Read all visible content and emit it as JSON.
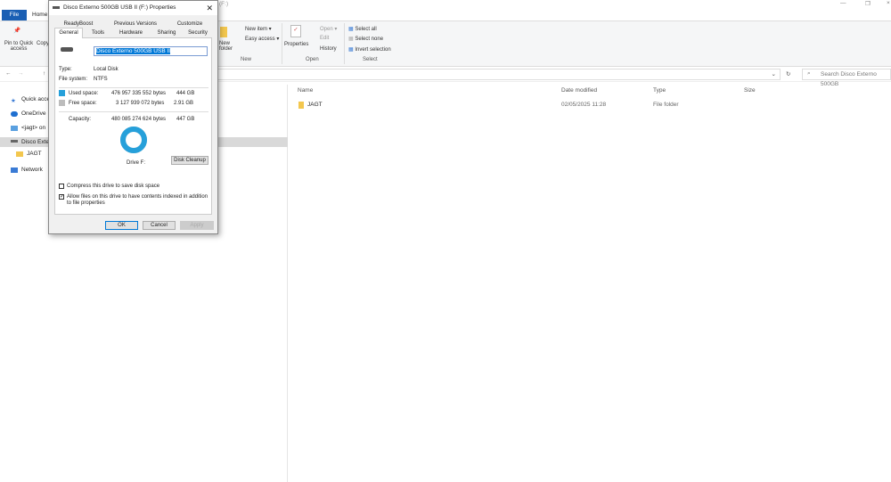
{
  "explorer": {
    "title_suffix": "(F:)",
    "tabs": {
      "file": "File",
      "home": "Home"
    },
    "ribbon": {
      "pin": "Pin to Quick access",
      "copy": "Copy",
      "new_folder": "New folder",
      "new_item": "New item ▾",
      "easy_access": "Easy access ▾",
      "properties": "Properties",
      "open": "Open ▾",
      "edit": "Edit",
      "history": "History",
      "select_all": "Select all",
      "select_none": "Select none",
      "invert_selection": "Invert selection",
      "groups": {
        "new": "New",
        "open": "Open",
        "select": "Select"
      }
    },
    "search_placeholder": "Search Disco Externo 500GB",
    "nav": [
      "Quick access",
      "OneDrive",
      "<jagt> on",
      "Disco Externo",
      "JAGT",
      "Network"
    ],
    "columns": [
      "Name",
      "Date modified",
      "Type",
      "Size"
    ],
    "files": [
      {
        "name": "JAGT",
        "date": "02/05/2025 11:28",
        "type": "File folder",
        "size": ""
      }
    ]
  },
  "dialog": {
    "title": "Disco Externo 500GB USB II (F:) Properties",
    "tabs_top": [
      "ReadyBoost",
      "Previous Versions",
      "Customize"
    ],
    "tabs_bottom": [
      "General",
      "Tools",
      "Hardware",
      "Sharing",
      "Security"
    ],
    "name_value": "Disco Externo 500GB USB II",
    "type_label": "Type:",
    "type_value": "Local Disk",
    "fs_label": "File system:",
    "fs_value": "NTFS",
    "used_label": "Used space:",
    "used_bytes": "476 957 335 552 bytes",
    "used_gb": "444 GB",
    "free_label": "Free space:",
    "free_bytes": "3 127 939 072 bytes",
    "free_gb": "2.91 GB",
    "cap_label": "Capacity:",
    "cap_bytes": "480 085 274 624 bytes",
    "cap_gb": "447 GB",
    "used_fraction": 0.9935,
    "used_color": "#26a0da",
    "free_color": "#bcbcbc",
    "drive_label": "Drive F:",
    "disk_cleanup": "Disk Cleanup",
    "compress": "Compress this drive to save disk space",
    "compress_checked": false,
    "index": "Allow files on this drive to have contents indexed in addition to file properties",
    "index_checked": true,
    "ok": "OK",
    "cancel": "Cancel",
    "apply": "Apply"
  }
}
